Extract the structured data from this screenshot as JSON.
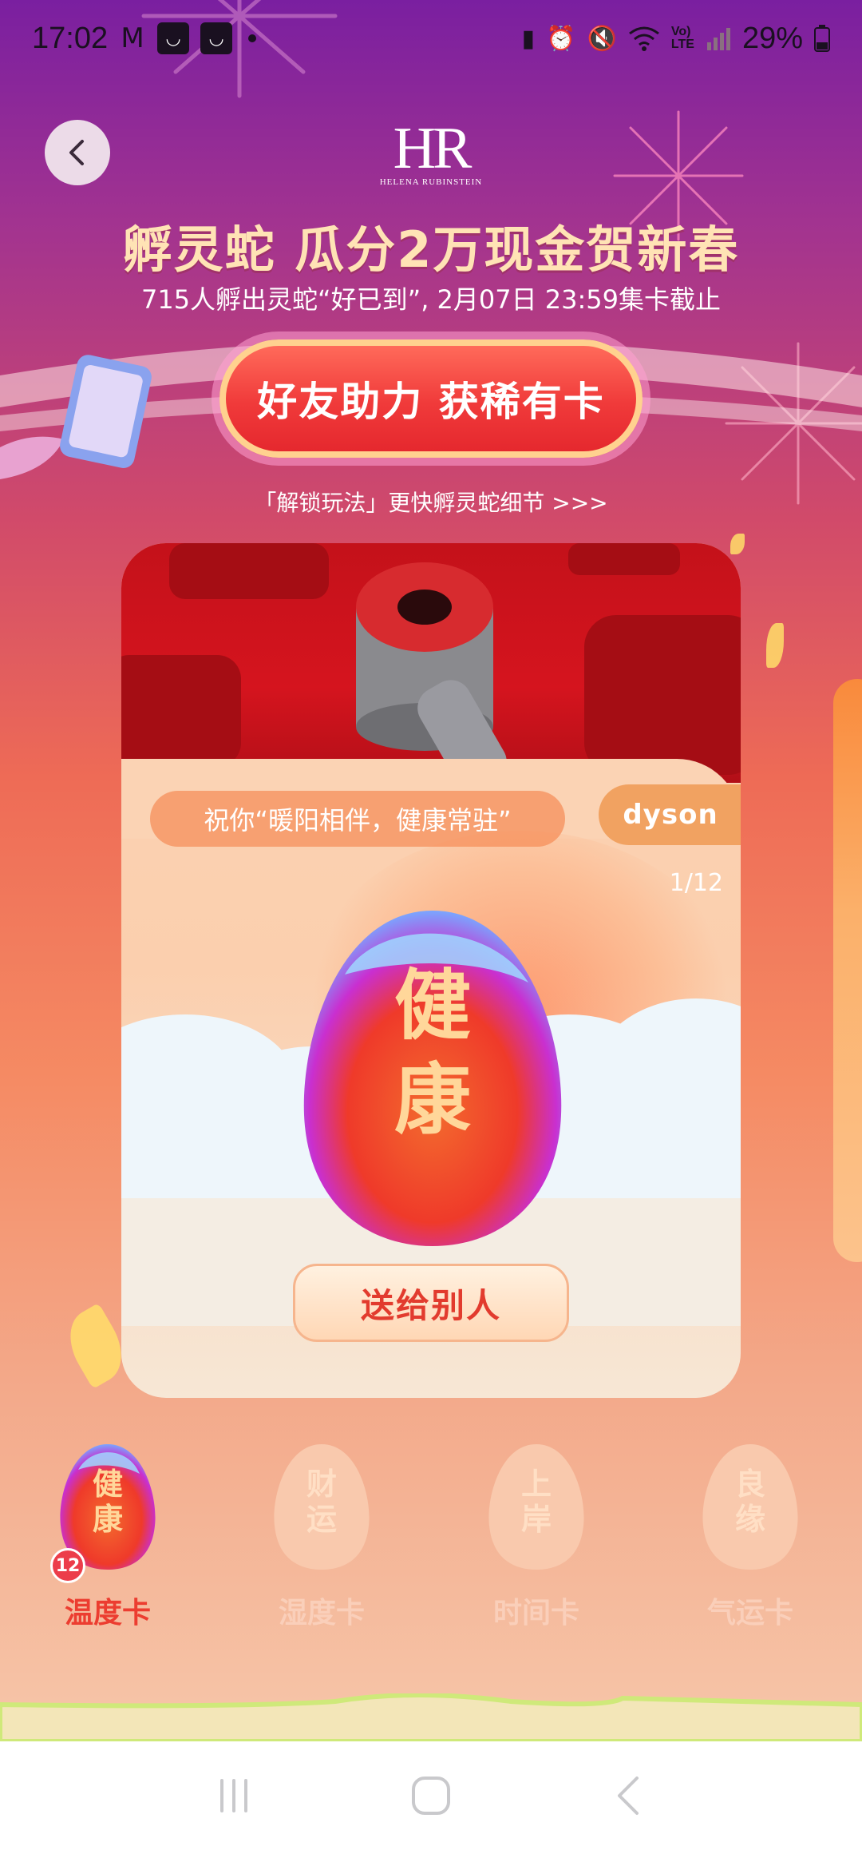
{
  "status_bar": {
    "time": "17:02",
    "battery": "29%",
    "notification_icons": [
      "gmail-icon",
      "app-icon",
      "app-icon"
    ],
    "system_icons": [
      "battery-saver-icon",
      "alarm-icon",
      "mute-icon",
      "wifi-icon",
      "volte-icon",
      "signal-icon",
      "battery-icon"
    ]
  },
  "header": {
    "brand_mark": "HR",
    "brand_name": "HELENA RUBINSTEIN",
    "headline": "孵灵蛇 瓜分2万现金贺新春",
    "subline": "715人孵出灵蛇“好已到”, 2月07日 23:59集卡截止"
  },
  "help_button": {
    "label": "好友助力 获稀有卡"
  },
  "unlock_link": {
    "label": "「解锁玩法」更快孵灵蛇细节 >>>"
  },
  "card": {
    "wish": "祝你“暖阳相伴，健康常驻”",
    "sponsor": "dyson",
    "page_indicator": "1/12",
    "egg_text": "健\n康",
    "send_button": "送给别人"
  },
  "card_tabs": [
    {
      "label": "温度卡",
      "egg_text": "健\n康",
      "count": "12",
      "active": true
    },
    {
      "label": "湿度卡",
      "egg_text": "财\n运",
      "active": false
    },
    {
      "label": "时间卡",
      "egg_text": "上\n岸",
      "active": false
    },
    {
      "label": "气运卡",
      "egg_text": "良\n缘",
      "active": false
    }
  ],
  "nav_bar": {
    "buttons": [
      "recent-apps",
      "home",
      "back"
    ]
  },
  "colors": {
    "primary_red": "#ec3d30",
    "headline_gold": "#ffe3b5",
    "card_peach": "#fbd3b4"
  }
}
